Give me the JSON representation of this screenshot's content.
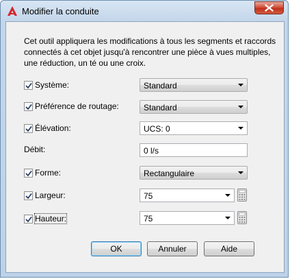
{
  "window": {
    "title": "Modifier la conduite",
    "icon": "autodesk-a-icon",
    "close_icon": "close-icon"
  },
  "description": {
    "line1": "Cet outil appliquera les modifications à tous les segments et raccords",
    "line2": "connectés à cet objet jusqu'à rencontrer une pièce à vues multiples,",
    "line3": "une réduction, un té ou une croix."
  },
  "fields": {
    "systeme": {
      "label": "Système:",
      "checked": true,
      "value": "Standard"
    },
    "preference": {
      "label": "Préférence de routage:",
      "checked": true,
      "value": "Standard"
    },
    "elevation": {
      "label": "Élévation:",
      "checked": true,
      "value": "UCS: 0"
    },
    "debit": {
      "label": "Débit:",
      "value": "0 l/s"
    },
    "forme": {
      "label": "Forme:",
      "checked": true,
      "value": "Rectangulaire"
    },
    "largeur": {
      "label": "Largeur:",
      "checked": true,
      "value": "75"
    },
    "hauteur": {
      "label": "Hauteur:",
      "checked": true,
      "value": "75"
    }
  },
  "buttons": {
    "ok": "OK",
    "cancel": "Annuler",
    "help": "Aide"
  },
  "colors": {
    "title_bar": "#c3d6ea",
    "close_button": "#c0301b",
    "client_bg": "#f0f0f0",
    "default_button_border": "#3c7fb1"
  }
}
